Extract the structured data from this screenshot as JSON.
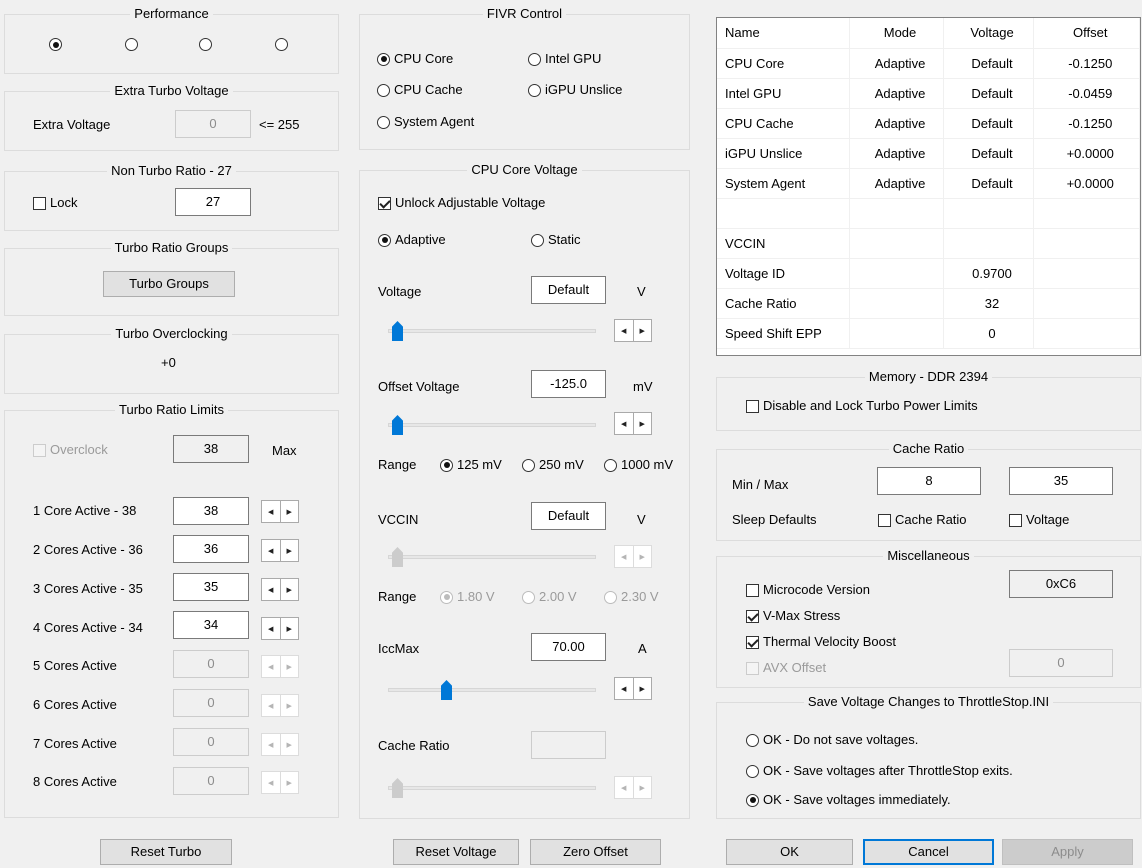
{
  "performance": {
    "title": "Performance",
    "options": [
      true,
      false,
      false,
      false
    ]
  },
  "extra_turbo": {
    "title": "Extra Turbo Voltage",
    "label": "Extra Voltage",
    "value": "0",
    "limit": "<= 255"
  },
  "non_turbo": {
    "title": "Non Turbo Ratio - 27",
    "lock_label": "Lock",
    "lock_checked": false,
    "value": "27"
  },
  "turbo_groups": {
    "title": "Turbo Ratio Groups",
    "button": "Turbo Groups"
  },
  "turbo_oc": {
    "title": "Turbo Overclocking",
    "value": "+0"
  },
  "turbo_limits": {
    "title": "Turbo Ratio Limits",
    "overclock_label": "Overclock",
    "overclock_value": "38",
    "max_label": "Max",
    "rows": [
      {
        "label": "1 Core  Active - 38",
        "value": "38",
        "enabled": true
      },
      {
        "label": "2 Cores Active - 36",
        "value": "36",
        "enabled": true
      },
      {
        "label": "3 Cores Active - 35",
        "value": "35",
        "enabled": true
      },
      {
        "label": "4 Cores Active - 34",
        "value": "34",
        "enabled": true
      },
      {
        "label": "5 Cores Active",
        "value": "0",
        "enabled": false
      },
      {
        "label": "6 Cores Active",
        "value": "0",
        "enabled": false
      },
      {
        "label": "7 Cores Active",
        "value": "0",
        "enabled": false
      },
      {
        "label": "8 Cores Active",
        "value": "0",
        "enabled": false
      }
    ],
    "reset_button": "Reset Turbo"
  },
  "fivr": {
    "title": "FIVR Control",
    "options": {
      "cpu_core": "CPU Core",
      "intel_gpu": "Intel GPU",
      "cpu_cache": "CPU Cache",
      "igpu_unslice": "iGPU Unslice",
      "system_agent": "System Agent"
    },
    "selected": "cpu_core"
  },
  "core_voltage": {
    "title": "CPU Core Voltage",
    "unlock_label": "Unlock Adjustable Voltage",
    "unlock_checked": true,
    "adaptive_label": "Adaptive",
    "static_label": "Static",
    "voltage_label": "Voltage",
    "voltage_value": "Default",
    "voltage_unit": "V",
    "voltage_slider": 0.02,
    "offset_label": "Offset Voltage",
    "offset_value": "-125.0",
    "offset_unit": "mV",
    "offset_slider": 0.02,
    "range_label": "Range",
    "range_options": [
      "125 mV",
      "250 mV",
      "1000 mV"
    ],
    "vccin_label": "VCCIN",
    "vccin_value": "Default",
    "vccin_unit": "V",
    "vccin_slider": 0.02,
    "vccin_range_label": "Range",
    "vccin_range_options": [
      "1.80 V",
      "2.00 V",
      "2.30 V"
    ],
    "iccmax_label": "IccMax",
    "iccmax_value": "70.00",
    "iccmax_unit": "A",
    "iccmax_slider": 0.27,
    "cache_ratio_label": "Cache Ratio",
    "cache_ratio_value": "",
    "cache_slider": 0.02,
    "reset_button": "Reset Voltage",
    "zero_button": "Zero Offset"
  },
  "voltage_table": {
    "headers": [
      "Name",
      "Mode",
      "Voltage",
      "Offset"
    ],
    "rows": [
      [
        "CPU Core",
        "Adaptive",
        "Default",
        "-0.1250"
      ],
      [
        "Intel GPU",
        "Adaptive",
        "Default",
        "-0.0459"
      ],
      [
        "CPU Cache",
        "Adaptive",
        "Default",
        "-0.1250"
      ],
      [
        "iGPU Unslice",
        "Adaptive",
        "Default",
        "+0.0000"
      ],
      [
        "System Agent",
        "Adaptive",
        "Default",
        "+0.0000"
      ],
      [
        "",
        "",
        "",
        ""
      ],
      [
        "VCCIN",
        "",
        "",
        ""
      ],
      [
        "Voltage ID",
        "",
        "0.9700",
        ""
      ],
      [
        "Cache Ratio",
        "",
        "32",
        ""
      ],
      [
        "Speed Shift EPP",
        "",
        "0",
        ""
      ]
    ]
  },
  "memory": {
    "title": "Memory - DDR 2394",
    "disable_label": "Disable and Lock Turbo Power Limits",
    "disable_checked": false
  },
  "cache_ratio": {
    "title": "Cache Ratio",
    "minmax_label": "Min / Max",
    "min": "8",
    "max": "35",
    "sleep_label": "Sleep Defaults",
    "sleep_cache_label": "Cache Ratio",
    "sleep_voltage_label": "Voltage"
  },
  "misc": {
    "title": "Miscellaneous",
    "microcode_label": "Microcode Version",
    "microcode_value": "0xC6",
    "vmax_label": "V-Max Stress",
    "tvb_label": "Thermal Velocity Boost",
    "avx_label": "AVX Offset",
    "avx_value": "0"
  },
  "save": {
    "title": "Save Voltage Changes to ThrottleStop.INI",
    "options": [
      "OK - Do not save voltages.",
      "OK - Save voltages after ThrottleStop exits.",
      "OK - Save voltages immediately."
    ],
    "selected": 2
  },
  "footer": {
    "ok": "OK",
    "cancel": "Cancel",
    "apply": "Apply"
  }
}
